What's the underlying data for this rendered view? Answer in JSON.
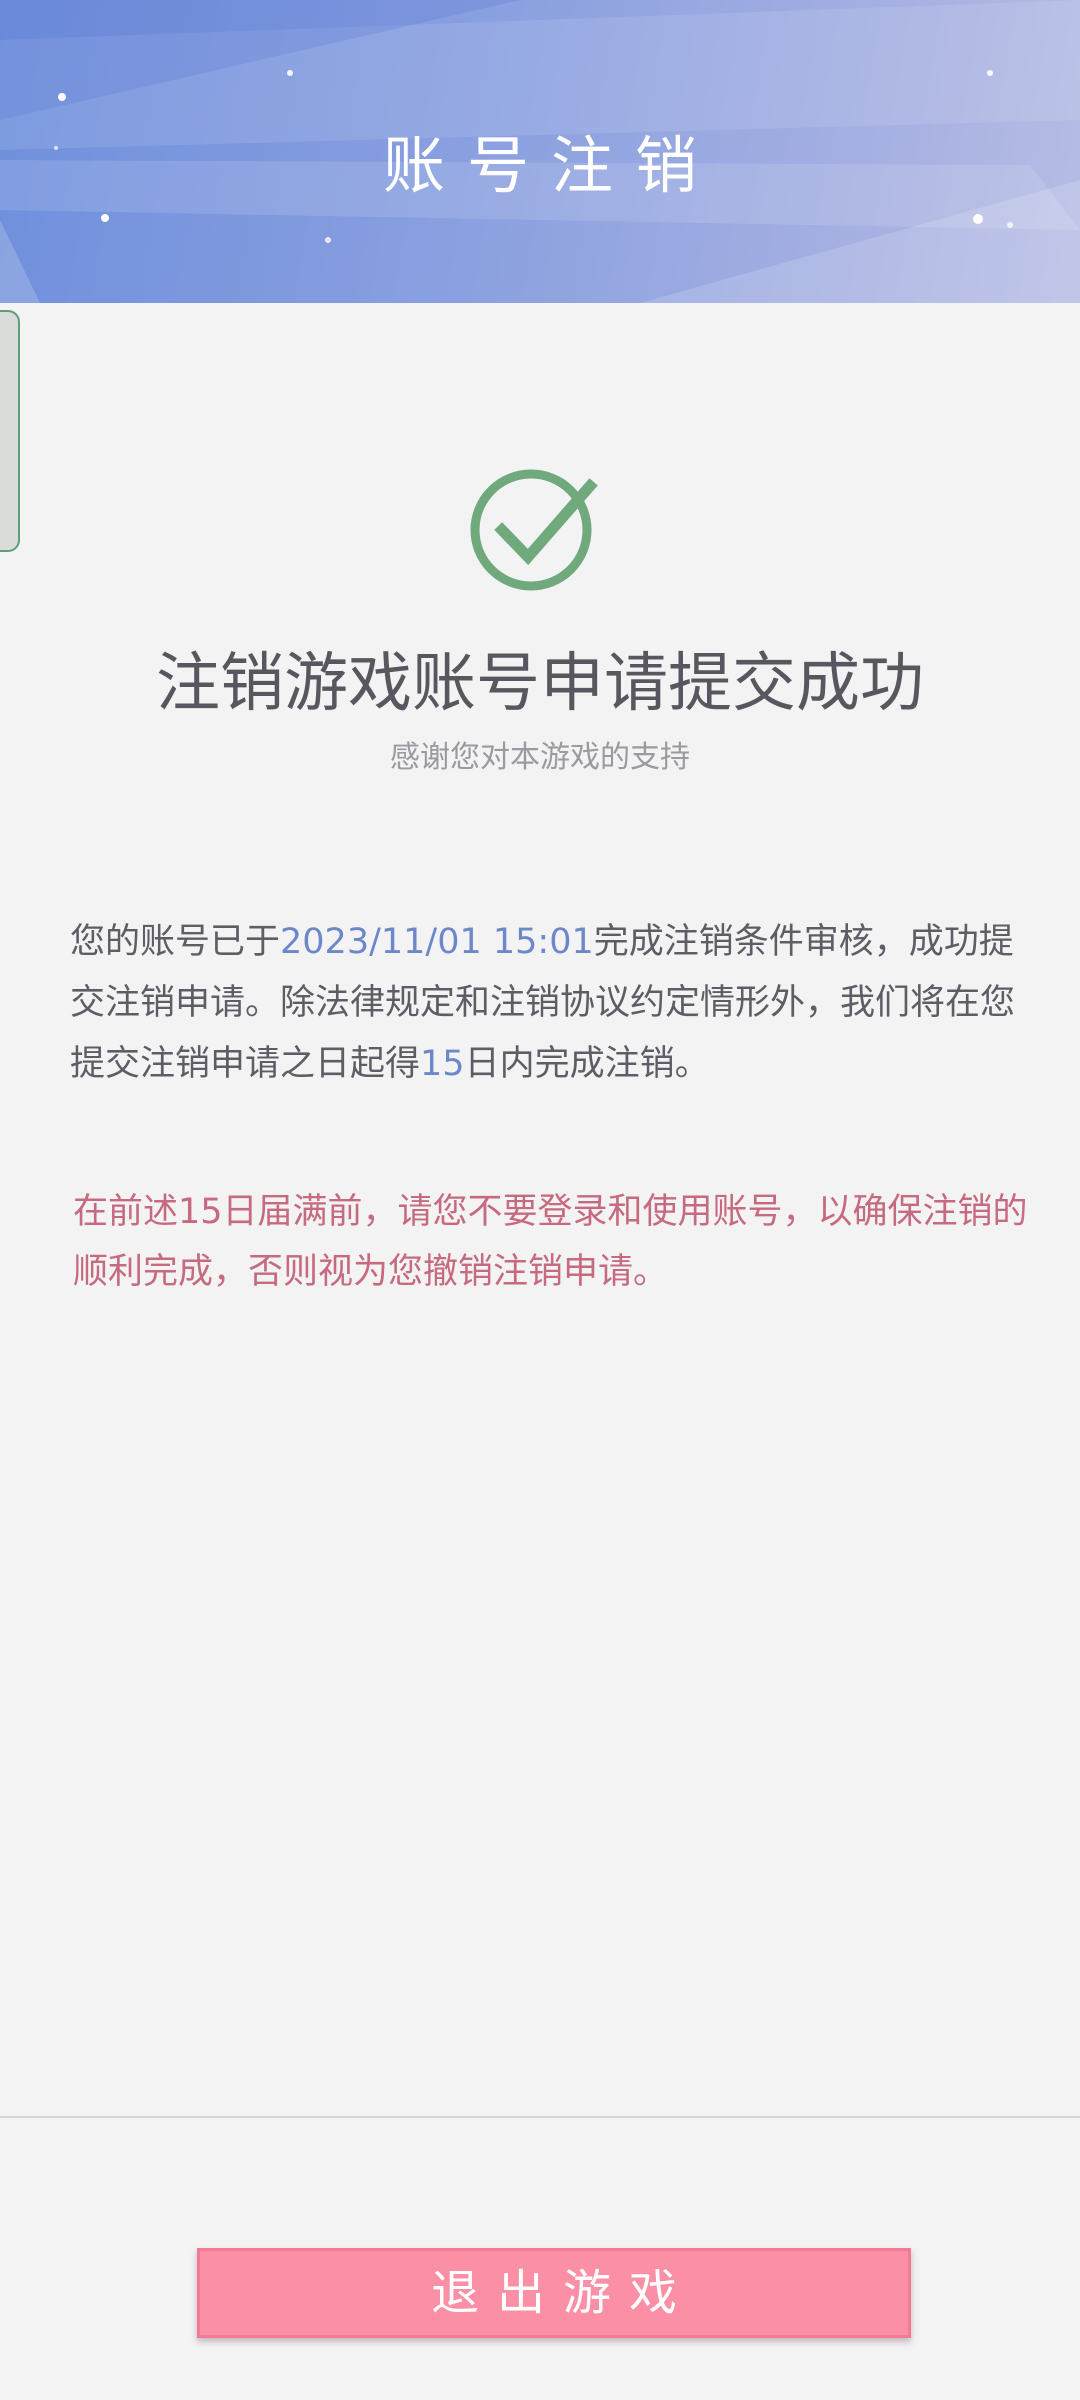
{
  "header": {
    "title": "账号注销"
  },
  "result": {
    "title": "注销游戏账号申请提交成功",
    "subtitle": "感谢您对本游戏的支持"
  },
  "notice": {
    "part1": "您的账号已于",
    "datetime": "2023/11/01 15:01",
    "part2": "完成注销条件审核，成功提交注销申请。除法律规定和注销协议约定情形外，我们将在您提交注销申请之日起得",
    "days": "15",
    "part3": "日内完成注销。"
  },
  "warning": {
    "text": "在前述15日届满前，请您不要登录和使用账号，以确保注销的顺利完成，否则视为您撤销注销申请。"
  },
  "footer": {
    "exit_label": "退出游戏"
  },
  "colors": {
    "header_gradient_start": "#6f8fdc",
    "check_green": "#6fa97c",
    "highlight_blue": "#6d88c9",
    "warning_red": "#c66a7f",
    "button_pink": "#fb8fa6"
  }
}
